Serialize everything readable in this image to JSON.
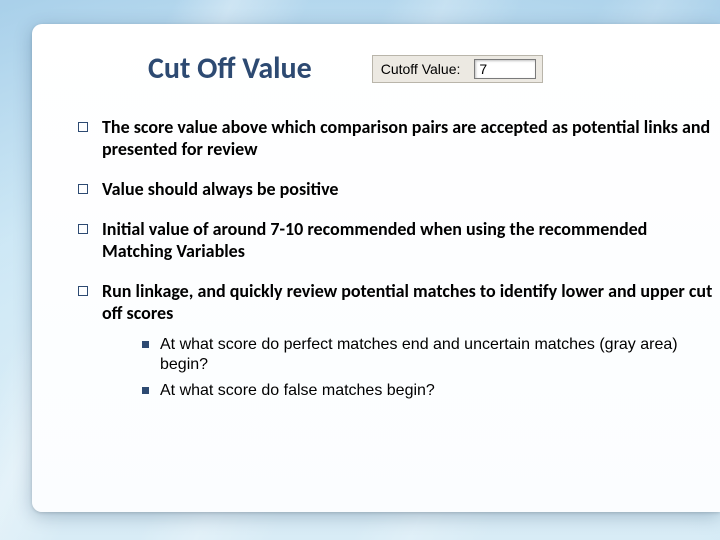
{
  "title": "Cut Off Value",
  "field": {
    "label": "Cutoff Value:",
    "value": "7"
  },
  "bullets": [
    "The score value above which comparison pairs are accepted as potential links and presented for review",
    "Value should always be positive",
    "Initial value of around 7-10 recommended when using the recommended Matching Variables",
    "Run linkage, and quickly review potential matches to identify lower and upper cut off scores"
  ],
  "sub_bullets": [
    "At what score do perfect matches end and uncertain matches (gray area) begin?",
    "At what score do false matches begin?"
  ]
}
